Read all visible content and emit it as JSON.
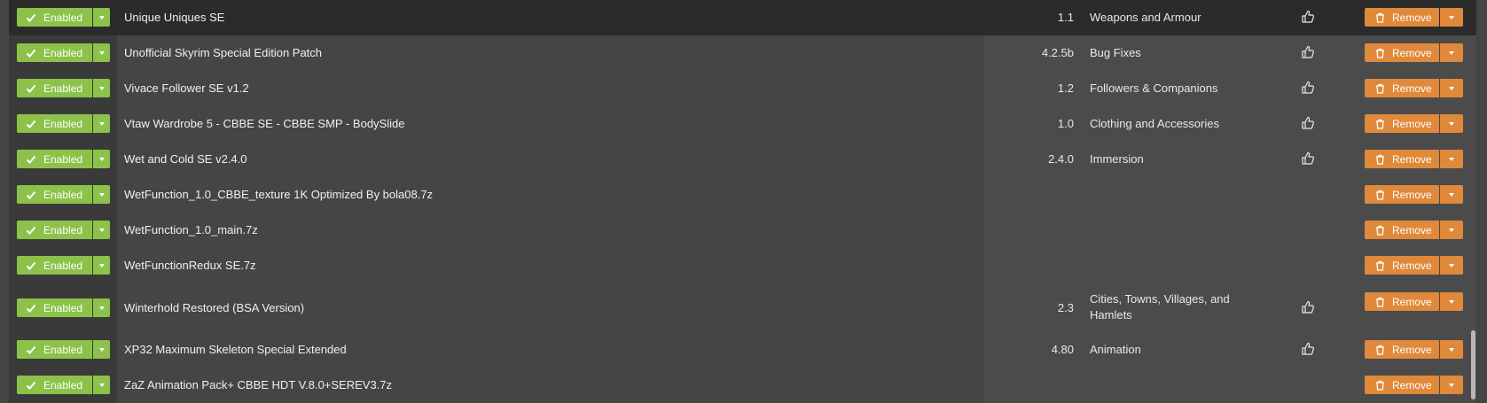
{
  "enabled_label": "Enabled",
  "remove_label": "Remove",
  "colors": {
    "enabled": "#8cc24a",
    "remove": "#e0893a",
    "background": "#454545"
  },
  "mods": [
    {
      "name": "Unique Uniques SE",
      "version": "1.1",
      "category": "Weapons and Armour",
      "endorse": true
    },
    {
      "name": "Unofficial Skyrim Special Edition Patch",
      "version": "4.2.5b",
      "category": "Bug Fixes",
      "endorse": true
    },
    {
      "name": "Vivace Follower SE v1.2",
      "version": "1.2",
      "category": "Followers & Companions",
      "endorse": true
    },
    {
      "name": "Vtaw Wardrobe 5 - CBBE SE - CBBE SMP - BodySlide",
      "version": "1.0",
      "category": "Clothing and Accessories",
      "endorse": true
    },
    {
      "name": "Wet and Cold SE v2.4.0",
      "version": "2.4.0",
      "category": "Immersion",
      "endorse": true
    },
    {
      "name": "WetFunction_1.0_CBBE_texture 1K Optimized By bola08.7z",
      "version": "",
      "category": "",
      "endorse": false
    },
    {
      "name": "WetFunction_1.0_main.7z",
      "version": "",
      "category": "",
      "endorse": false
    },
    {
      "name": "WetFunctionRedux SE.7z",
      "version": "",
      "category": "",
      "endorse": false
    },
    {
      "name": "Winterhold Restored (BSA Version)",
      "version": "2.3",
      "category": "Cities, Towns, Villages, and Hamlets",
      "endorse": true
    },
    {
      "name": "XP32 Maximum Skeleton Special Extended",
      "version": "4.80",
      "category": "Animation",
      "endorse": true
    },
    {
      "name": "ZaZ Animation Pack+ CBBE HDT V.8.0+SEREV3.7z",
      "version": "",
      "category": "",
      "endorse": false
    }
  ]
}
